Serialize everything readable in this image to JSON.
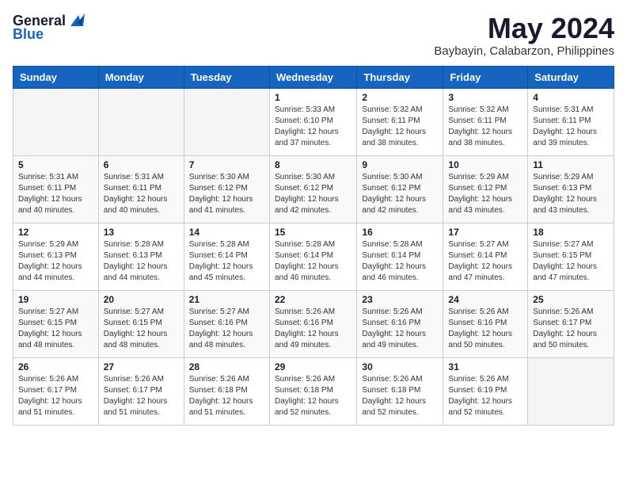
{
  "logo": {
    "general": "General",
    "blue": "Blue"
  },
  "title": "May 2024",
  "location": "Baybayin, Calabarzon, Philippines",
  "days_header": [
    "Sunday",
    "Monday",
    "Tuesday",
    "Wednesday",
    "Thursday",
    "Friday",
    "Saturday"
  ],
  "weeks": [
    [
      {
        "day": "",
        "info": ""
      },
      {
        "day": "",
        "info": ""
      },
      {
        "day": "",
        "info": ""
      },
      {
        "day": "1",
        "info": "Sunrise: 5:33 AM\nSunset: 6:10 PM\nDaylight: 12 hours\nand 37 minutes."
      },
      {
        "day": "2",
        "info": "Sunrise: 5:32 AM\nSunset: 6:11 PM\nDaylight: 12 hours\nand 38 minutes."
      },
      {
        "day": "3",
        "info": "Sunrise: 5:32 AM\nSunset: 6:11 PM\nDaylight: 12 hours\nand 38 minutes."
      },
      {
        "day": "4",
        "info": "Sunrise: 5:31 AM\nSunset: 6:11 PM\nDaylight: 12 hours\nand 39 minutes."
      }
    ],
    [
      {
        "day": "5",
        "info": "Sunrise: 5:31 AM\nSunset: 6:11 PM\nDaylight: 12 hours\nand 40 minutes."
      },
      {
        "day": "6",
        "info": "Sunrise: 5:31 AM\nSunset: 6:11 PM\nDaylight: 12 hours\nand 40 minutes."
      },
      {
        "day": "7",
        "info": "Sunrise: 5:30 AM\nSunset: 6:12 PM\nDaylight: 12 hours\nand 41 minutes."
      },
      {
        "day": "8",
        "info": "Sunrise: 5:30 AM\nSunset: 6:12 PM\nDaylight: 12 hours\nand 42 minutes."
      },
      {
        "day": "9",
        "info": "Sunrise: 5:30 AM\nSunset: 6:12 PM\nDaylight: 12 hours\nand 42 minutes."
      },
      {
        "day": "10",
        "info": "Sunrise: 5:29 AM\nSunset: 6:12 PM\nDaylight: 12 hours\nand 43 minutes."
      },
      {
        "day": "11",
        "info": "Sunrise: 5:29 AM\nSunset: 6:13 PM\nDaylight: 12 hours\nand 43 minutes."
      }
    ],
    [
      {
        "day": "12",
        "info": "Sunrise: 5:29 AM\nSunset: 6:13 PM\nDaylight: 12 hours\nand 44 minutes."
      },
      {
        "day": "13",
        "info": "Sunrise: 5:28 AM\nSunset: 6:13 PM\nDaylight: 12 hours\nand 44 minutes."
      },
      {
        "day": "14",
        "info": "Sunrise: 5:28 AM\nSunset: 6:14 PM\nDaylight: 12 hours\nand 45 minutes."
      },
      {
        "day": "15",
        "info": "Sunrise: 5:28 AM\nSunset: 6:14 PM\nDaylight: 12 hours\nand 46 minutes."
      },
      {
        "day": "16",
        "info": "Sunrise: 5:28 AM\nSunset: 6:14 PM\nDaylight: 12 hours\nand 46 minutes."
      },
      {
        "day": "17",
        "info": "Sunrise: 5:27 AM\nSunset: 6:14 PM\nDaylight: 12 hours\nand 47 minutes."
      },
      {
        "day": "18",
        "info": "Sunrise: 5:27 AM\nSunset: 6:15 PM\nDaylight: 12 hours\nand 47 minutes."
      }
    ],
    [
      {
        "day": "19",
        "info": "Sunrise: 5:27 AM\nSunset: 6:15 PM\nDaylight: 12 hours\nand 48 minutes."
      },
      {
        "day": "20",
        "info": "Sunrise: 5:27 AM\nSunset: 6:15 PM\nDaylight: 12 hours\nand 48 minutes."
      },
      {
        "day": "21",
        "info": "Sunrise: 5:27 AM\nSunset: 6:16 PM\nDaylight: 12 hours\nand 48 minutes."
      },
      {
        "day": "22",
        "info": "Sunrise: 5:26 AM\nSunset: 6:16 PM\nDaylight: 12 hours\nand 49 minutes."
      },
      {
        "day": "23",
        "info": "Sunrise: 5:26 AM\nSunset: 6:16 PM\nDaylight: 12 hours\nand 49 minutes."
      },
      {
        "day": "24",
        "info": "Sunrise: 5:26 AM\nSunset: 6:16 PM\nDaylight: 12 hours\nand 50 minutes."
      },
      {
        "day": "25",
        "info": "Sunrise: 5:26 AM\nSunset: 6:17 PM\nDaylight: 12 hours\nand 50 minutes."
      }
    ],
    [
      {
        "day": "26",
        "info": "Sunrise: 5:26 AM\nSunset: 6:17 PM\nDaylight: 12 hours\nand 51 minutes."
      },
      {
        "day": "27",
        "info": "Sunrise: 5:26 AM\nSunset: 6:17 PM\nDaylight: 12 hours\nand 51 minutes."
      },
      {
        "day": "28",
        "info": "Sunrise: 5:26 AM\nSunset: 6:18 PM\nDaylight: 12 hours\nand 51 minutes."
      },
      {
        "day": "29",
        "info": "Sunrise: 5:26 AM\nSunset: 6:18 PM\nDaylight: 12 hours\nand 52 minutes."
      },
      {
        "day": "30",
        "info": "Sunrise: 5:26 AM\nSunset: 6:18 PM\nDaylight: 12 hours\nand 52 minutes."
      },
      {
        "day": "31",
        "info": "Sunrise: 5:26 AM\nSunset: 6:19 PM\nDaylight: 12 hours\nand 52 minutes."
      },
      {
        "day": "",
        "info": ""
      }
    ]
  ]
}
